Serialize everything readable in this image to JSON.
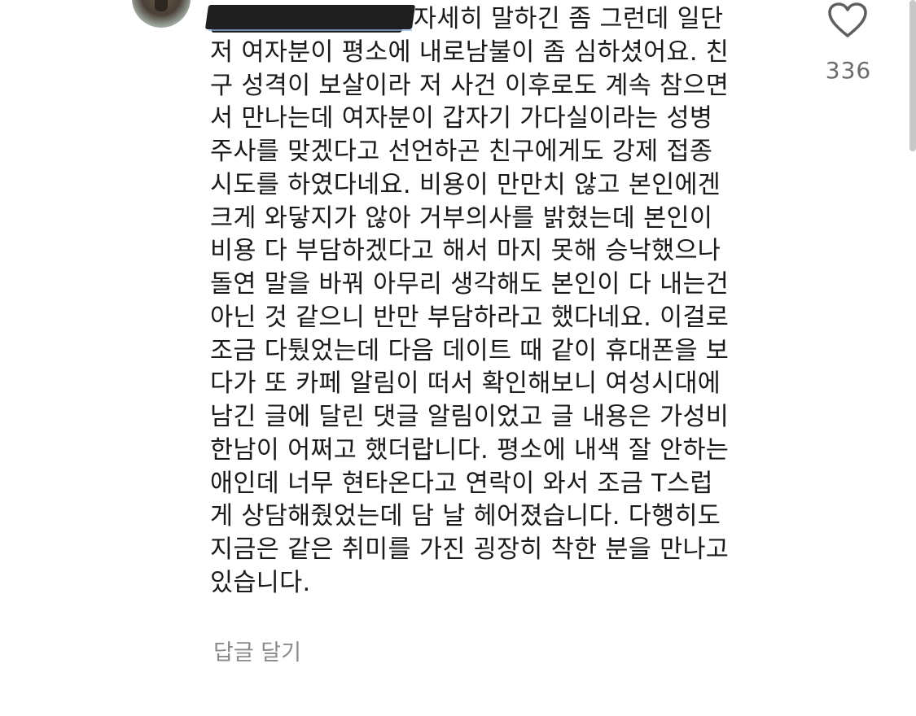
{
  "comment": {
    "lines": [
      "자세히 말하긴 좀 그런데 일단",
      "저 여자분이 평소에 내로남불이 좀 심하셨어요. 친",
      "구 성격이 보살이라 저 사건 이후로도 계속 참으면",
      "서 만나는데 여자분이 갑자기 가다실이라는 성병",
      "주사를 맞겠다고 선언하곤 친구에게도 강제 접종",
      "시도를 하였다네요. 비용이 만만치 않고 본인에겐",
      "크게 와닿지가 않아 거부의사를 밝혔는데 본인이",
      "비용 다 부담하겠다고 해서 마지 못해 승낙했으나",
      "돌연 말을 바꿔 아무리 생각해도 본인이 다 내는건",
      "아닌 것 같으니 반만 부담하라고 했다네요. 이걸로",
      "조금 다퉜었는데 다음 데이트 때 같이 휴대폰을 보",
      "다가 또 카페 알림이 떠서 확인해보니 여성시대에",
      "남긴 글에 달린 댓글 알림이었고 글 내용은 가성비",
      "한남이 어쩌고 했더랍니다. 평소에 내색 잘 안하는",
      "애인데 너무 현타온다고 연락이 와서 조금 T스럽",
      "게 상담해줬었는데 담 날 헤어졌습니다. 다행히도",
      "지금은 같은 취미를 가진 굉장히 착한 분을 만나고",
      "있습니다."
    ]
  },
  "like": {
    "count": "336",
    "icon": "heart-outline-icon"
  },
  "actions": {
    "reply_label": "답글 달기"
  },
  "colors": {
    "text": "#1a1a1a",
    "muted": "#8a8a8a",
    "like_count": "#6b6b6b",
    "icon_stroke": "#5f5f5f"
  }
}
